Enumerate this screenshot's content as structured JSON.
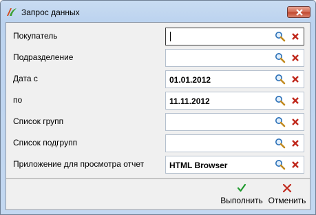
{
  "window": {
    "title": "Запрос данных"
  },
  "form": {
    "fields": [
      {
        "label": "Покупатель",
        "value": "",
        "focused": true
      },
      {
        "label": "Подразделение",
        "value": ""
      },
      {
        "label": "Дата с",
        "value": "01.01.2012"
      },
      {
        "label": "по",
        "value": "11.11.2012"
      },
      {
        "label": "Список групп",
        "value": ""
      },
      {
        "label": "Список подгрупп",
        "value": ""
      },
      {
        "label": "Приложение для просмотра отчет",
        "value": "HTML Browser"
      }
    ]
  },
  "buttons": {
    "execute": "Выполнить",
    "cancel": "Отменить"
  },
  "colors": {
    "accept_green": "#1f9a2e",
    "cancel_red": "#c0281c"
  }
}
